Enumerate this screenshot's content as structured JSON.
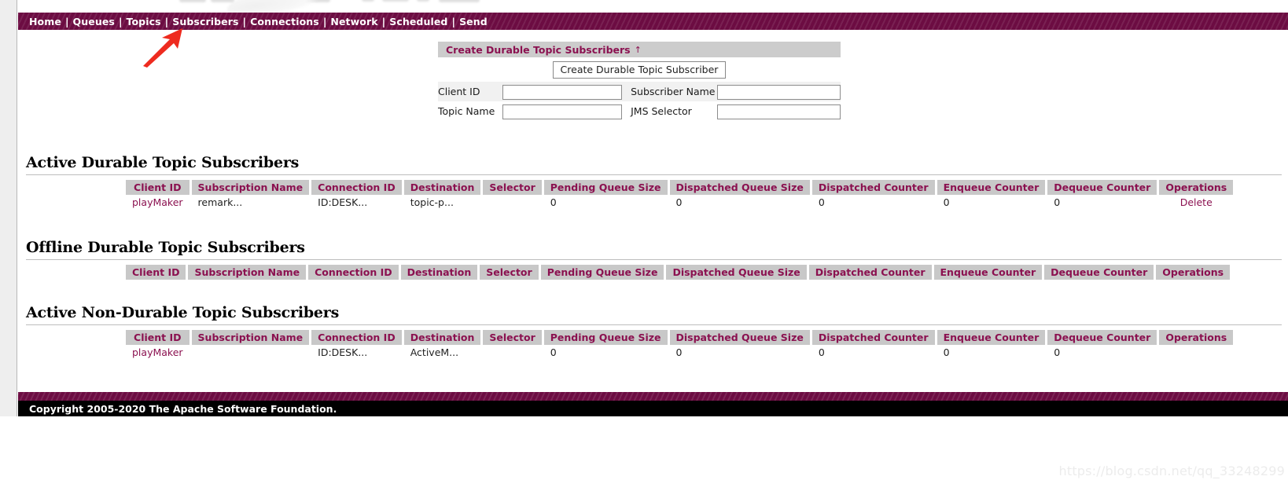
{
  "nav": {
    "items": [
      {
        "label": "Home"
      },
      {
        "label": "Queues"
      },
      {
        "label": "Topics"
      },
      {
        "label": "Subscribers"
      },
      {
        "label": "Connections"
      },
      {
        "label": "Network"
      },
      {
        "label": "Scheduled"
      },
      {
        "label": "Send"
      }
    ],
    "separator": "|"
  },
  "create_form": {
    "title": "Create Durable Topic Subscribers",
    "collapse_marker": "↑",
    "submit_label": "Create Durable Topic Subscriber",
    "fields": {
      "client_id_label": "Client ID",
      "client_id_value": "",
      "subscriber_name_label": "Subscriber Name",
      "subscriber_name_value": "",
      "topic_name_label": "Topic Name",
      "topic_name_value": "",
      "jms_selector_label": "JMS Selector",
      "jms_selector_value": ""
    }
  },
  "columns": [
    "Client ID",
    "Subscription Name",
    "Connection ID",
    "Destination",
    "Selector",
    "Pending Queue Size",
    "Dispatched Queue Size",
    "Dispatched Counter",
    "Enqueue Counter",
    "Dequeue Counter",
    "Operations"
  ],
  "sections": [
    {
      "id": "active-durable",
      "heading": "Active Durable Topic Subscribers",
      "rows": [
        {
          "client_id": "playMaker",
          "subscription_name": "remark...",
          "connection_id": "ID:DESK...",
          "destination": "topic-p...",
          "selector": "",
          "pending_queue_size": "0",
          "dispatched_queue_size": "0",
          "dispatched_counter": "0",
          "enqueue_counter": "0",
          "dequeue_counter": "0",
          "operations": "Delete"
        }
      ]
    },
    {
      "id": "offline-durable",
      "heading": "Offline Durable Topic Subscribers",
      "rows": []
    },
    {
      "id": "active-non-durable",
      "heading": "Active Non-Durable Topic Subscribers",
      "rows": [
        {
          "client_id": "playMaker",
          "subscription_name": "",
          "connection_id": "ID:DESK...",
          "destination": "ActiveM...",
          "selector": "",
          "pending_queue_size": "0",
          "dispatched_queue_size": "0",
          "dispatched_counter": "0",
          "enqueue_counter": "0",
          "dequeue_counter": "0",
          "operations": ""
        }
      ]
    }
  ],
  "footer": {
    "copyright": "Copyright 2005-2020 The Apache Software Foundation."
  },
  "watermark": {
    "text": "https://blog.csdn.net/qq_33248299"
  },
  "colors": {
    "brand_magenta": "#6c0c42",
    "link_magenta": "#8b1150",
    "header_gray": "#c8c8c8",
    "annotation_red": "#ee2b1f"
  }
}
